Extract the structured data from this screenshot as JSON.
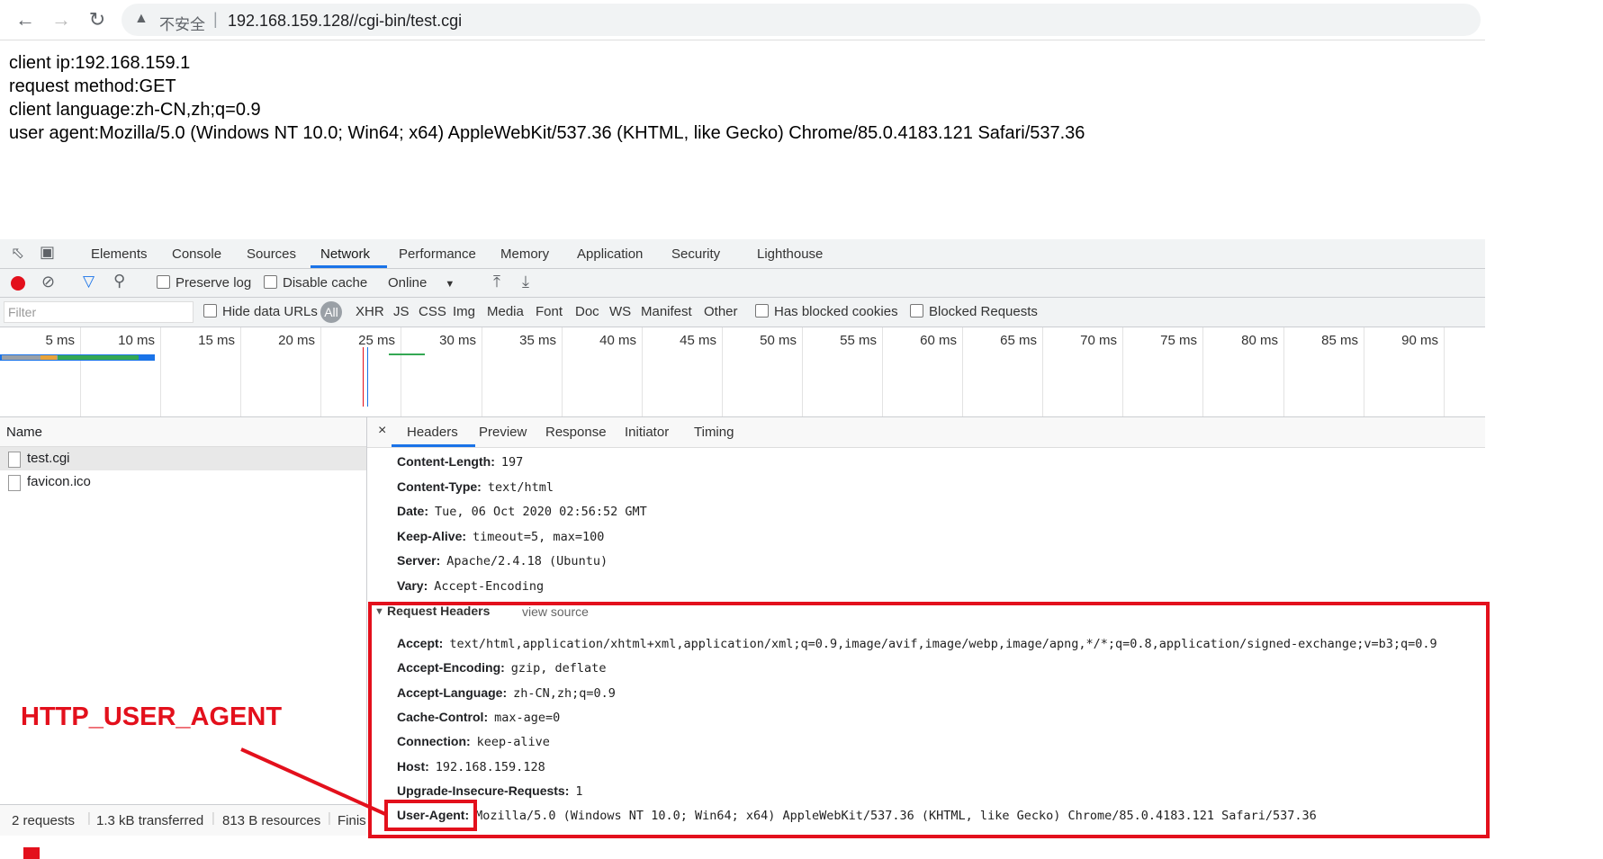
{
  "browser": {
    "back_icon": "arrow-left-icon",
    "forward_icon": "arrow-right-icon",
    "reload_icon": "reload-icon",
    "security_icon": "warning-triangle-icon",
    "insecure_label": "不安全",
    "url": "192.168.159.128//cgi-bin/test.cgi"
  },
  "page": {
    "lines": [
      "client ip:192.168.159.1",
      "request method:GET",
      "client language:zh-CN,zh;q=0.9",
      "user agent:Mozilla/5.0 (Windows NT 10.0; Win64; x64) AppleWebKit/537.36 (KHTML, like Gecko) Chrome/85.0.4183.121 Safari/537.36"
    ]
  },
  "devtools": {
    "tabs": [
      "Elements",
      "Console",
      "Sources",
      "Network",
      "Performance",
      "Memory",
      "Application",
      "Security",
      "Lighthouse"
    ],
    "active_tab": "Network",
    "toolbar": {
      "preserve_log": "Preserve log",
      "disable_cache": "Disable cache",
      "throttle": "Online"
    },
    "filterbar": {
      "filter_placeholder": "Filter",
      "hide_data_urls": "Hide data URLs",
      "all": "All",
      "types": [
        "XHR",
        "JS",
        "CSS",
        "Img",
        "Media",
        "Font",
        "Doc",
        "WS",
        "Manifest",
        "Other"
      ],
      "has_blocked_cookies": "Has blocked cookies",
      "blocked_requests": "Blocked Requests"
    },
    "timeline_ticks": [
      "5 ms",
      "10 ms",
      "15 ms",
      "20 ms",
      "25 ms",
      "30 ms",
      "35 ms",
      "40 ms",
      "45 ms",
      "50 ms",
      "55 ms",
      "60 ms",
      "65 ms",
      "70 ms",
      "75 ms",
      "80 ms",
      "85 ms",
      "90 ms"
    ],
    "name_header": "Name",
    "requests": [
      "test.cgi",
      "favicon.ico"
    ],
    "status": {
      "requests": "2 requests",
      "transferred": "1.3 kB transferred",
      "resources": "813 B resources",
      "finish": "Finis"
    },
    "detail_tabs": [
      "Headers",
      "Preview",
      "Response",
      "Initiator",
      "Timing"
    ],
    "detail_close": "×",
    "response_headers": [
      {
        "name": "Content-Length:",
        "value": "197"
      },
      {
        "name": "Content-Type:",
        "value": "text/html"
      },
      {
        "name": "Date:",
        "value": "Tue, 06 Oct 2020 02:56:52 GMT"
      },
      {
        "name": "Keep-Alive:",
        "value": "timeout=5, max=100"
      },
      {
        "name": "Server:",
        "value": "Apache/2.4.18 (Ubuntu)"
      },
      {
        "name": "Vary:",
        "value": "Accept-Encoding"
      }
    ],
    "request_section": {
      "title": "Request Headers",
      "view_source": "view source"
    },
    "request_headers": [
      {
        "name": "Accept:",
        "value": "text/html,application/xhtml+xml,application/xml;q=0.9,image/avif,image/webp,image/apng,*/*;q=0.8,application/signed-exchange;v=b3;q=0.9"
      },
      {
        "name": "Accept-Encoding:",
        "value": "gzip, deflate"
      },
      {
        "name": "Accept-Language:",
        "value": "zh-CN,zh;q=0.9"
      },
      {
        "name": "Cache-Control:",
        "value": "max-age=0"
      },
      {
        "name": "Connection:",
        "value": "keep-alive"
      },
      {
        "name": "Host:",
        "value": "192.168.159.128"
      },
      {
        "name": "Upgrade-Insecure-Requests:",
        "value": "1"
      },
      {
        "name": "User-Agent:",
        "value": "Mozilla/5.0 (Windows NT 10.0; Win64; x64) AppleWebKit/537.36 (KHTML, like Gecko) Chrome/85.0.4183.121 Safari/537.36"
      }
    ]
  },
  "annotation": {
    "label": "HTTP_USER_AGENT",
    "color": "#e3101c"
  }
}
